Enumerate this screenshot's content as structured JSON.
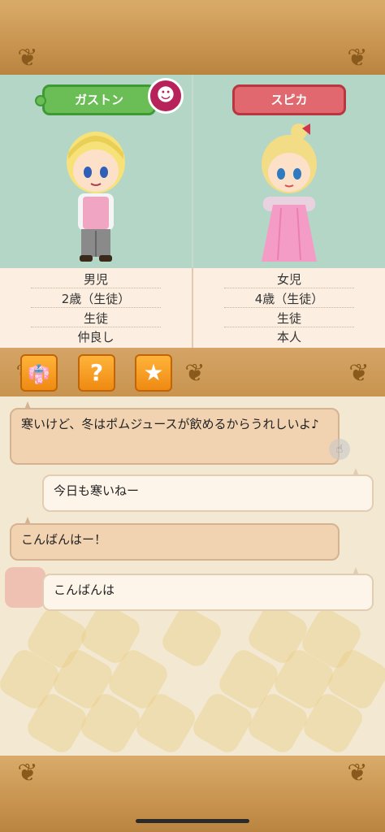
{
  "characters": {
    "left": {
      "name": "ガストン",
      "gender": "男児",
      "age": "2歳（生徒）",
      "role": "生徒",
      "relation": "仲良し",
      "badge_icon": "smile-icon"
    },
    "right": {
      "name": "スピカ",
      "gender": "女児",
      "age": "4歳（生徒）",
      "role": "生徒",
      "relation": "本人"
    }
  },
  "toolbar": [
    {
      "icon": "outfit-icon",
      "glyph": "👘"
    },
    {
      "icon": "question-icon",
      "glyph": "?"
    },
    {
      "icon": "star-icon",
      "glyph": "★"
    }
  ],
  "chat": [
    {
      "speaker": "npc",
      "text": "寒いけど、冬はポムジュースが飲めるからうれしいよ♪"
    },
    {
      "speaker": "me",
      "text": "今日も寒いねー"
    },
    {
      "speaker": "npc",
      "text": "こんばんはー！"
    },
    {
      "speaker": "me",
      "text": "こんばんは"
    }
  ],
  "colors": {
    "wood": "#c8944f",
    "panel_green": "#b4d6c6",
    "tag_green": "#6bbd55",
    "tag_red": "#e0686e",
    "button_orange": "#ef8a12"
  }
}
